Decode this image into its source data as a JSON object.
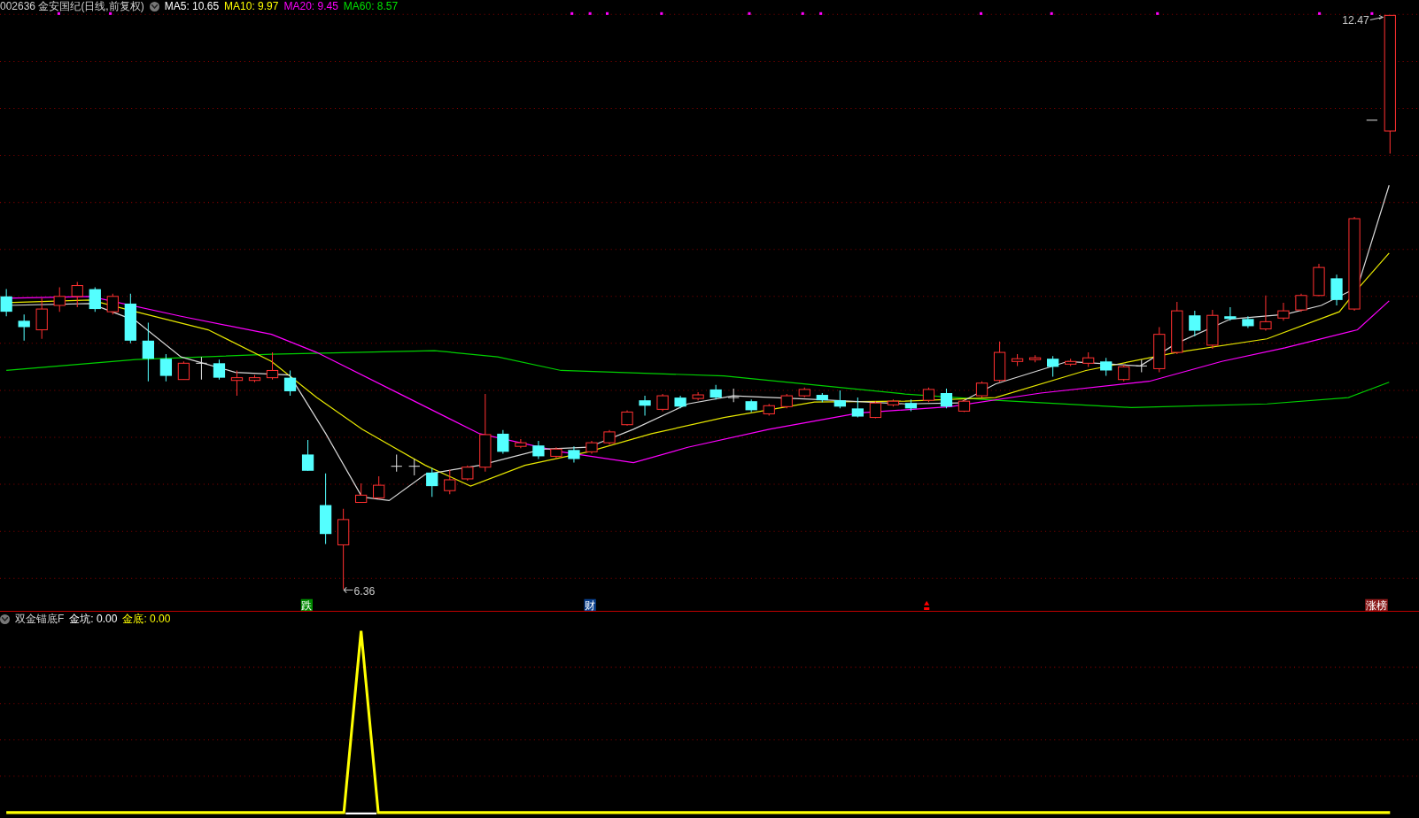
{
  "header": {
    "code": "002636",
    "name": "金安国纪",
    "mode": "(日线,前复权)",
    "indicators": [
      {
        "label": "MA5: 10.65",
        "color": "#ffffff"
      },
      {
        "label": "MA10: 9.97",
        "color": "#ffff00"
      },
      {
        "label": "MA20: 9.45",
        "color": "#ff00ff"
      },
      {
        "label": "MA60: 8.57",
        "color": "#00e000"
      }
    ]
  },
  "price_labels": {
    "high": "12.47",
    "low": "6.36"
  },
  "markers": [
    {
      "kind": "text",
      "label": "跌",
      "color": "#008a00"
    },
    {
      "kind": "text",
      "label": "财",
      "color": "#0a3f8c"
    },
    {
      "kind": "icon",
      "color": "#ff0000"
    },
    {
      "kind": "text",
      "label": "涨榜",
      "color": "#8b1a1a"
    }
  ],
  "lower_panel": {
    "title": "双金锚底F",
    "indicators": [
      {
        "label": "金坑: 0.00",
        "color": "#ffffff"
      },
      {
        "label": "金底: 0.00",
        "color": "#ffff00"
      }
    ]
  }
}
